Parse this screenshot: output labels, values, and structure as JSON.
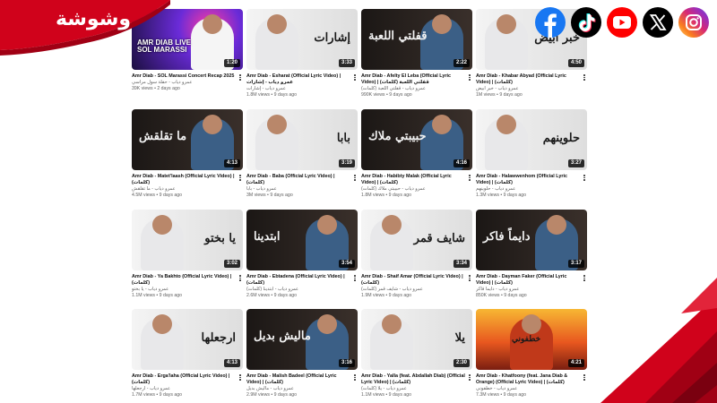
{
  "logo": {
    "text": "وشوشة",
    "color": "#d0021b"
  },
  "socials": [
    {
      "icon": "facebook-icon",
      "color": "#1877f2"
    },
    {
      "icon": "tiktok-icon",
      "color": "#000000"
    },
    {
      "icon": "youtube-icon",
      "color": "#ff0000"
    },
    {
      "icon": "x-icon",
      "color": "#000000"
    },
    {
      "icon": "instagram-icon",
      "color": "#d62976"
    }
  ],
  "videos": [
    {
      "title": "Amr Diab - SOL Marassi Concert Recap 2025",
      "channel": "عمرو دياب - حفلة سول مراسي",
      "stats": "39K views • 2 days ago",
      "duration": "1:20",
      "thumb_text": "AMR DIAB LIVE SOL MARASSI",
      "theme": "concert"
    },
    {
      "title": "Amr Diab - Esharat (Official Lyric Video) | عمرو دياب - إشارات",
      "channel": "عمرو دياب - إشارات",
      "stats": "1.8M views • 9 days ago",
      "duration": "3:33",
      "thumb_text": "إشارات",
      "theme": "light"
    },
    {
      "title": "Amr Diab - Afelty El Leba (Official Lyric Video) | (كلمات) قفلتي اللعبة",
      "channel": "عمرو دياب - قفلتي اللعبة (كلمات)",
      "stats": "990K views • 9 days ago",
      "duration": "2:22",
      "thumb_text": "قفلتي اللعبة",
      "theme": "dark"
    },
    {
      "title": "Amr Diab - Khabar Abyad (Official Lyric Video) | (كلمات)",
      "channel": "عمرو دياب - خبر أبيض",
      "stats": "1M views • 9 days ago",
      "duration": "4:50",
      "thumb_text": "خبر أبيض",
      "theme": "light"
    },
    {
      "title": "Amr Diab - Matet'laash (Official Lyric Video) | (كلمات)",
      "channel": "عمرو دياب - ما تقلقش",
      "stats": "4.5M views • 9 days ago",
      "duration": "4:13",
      "thumb_text": "ما تقلقش",
      "theme": "dark"
    },
    {
      "title": "Amr Diab - Baba (Official Lyric Video) | (كلمات)",
      "channel": "عمرو دياب - بابا",
      "stats": "3M views • 9 days ago",
      "duration": "3:19",
      "thumb_text": "بابا",
      "theme": "light"
    },
    {
      "title": "Amr Diab - Habibty Malak (Official Lyric Video) | (كلمات)",
      "channel": "عمرو دياب - حبيبتي ملاك (كلمات)",
      "stats": "1.8M views • 9 days ago",
      "duration": "4:16",
      "thumb_text": "حبيبتي ملاك",
      "theme": "dark"
    },
    {
      "title": "Amr Diab - Halawwenhom (Official Lyric Video) | (كلمات)",
      "channel": "عمرو دياب - حلوينهم",
      "stats": "1.3M views • 9 days ago",
      "duration": "3:27",
      "thumb_text": "حلوينهم",
      "theme": "light"
    },
    {
      "title": "Amr Diab - Ya Bakhto (Official Lyric Video) | (كلمات)",
      "channel": "عمرو دياب - يا بختو",
      "stats": "1.1M views • 9 days ago",
      "duration": "3:02",
      "thumb_text": "يا بختو",
      "theme": "light"
    },
    {
      "title": "Amr Diab - Ebtadena (Official Lyric Video) | (كلمات)",
      "channel": "عمرو دياب - ابتدينا (كلمات)",
      "stats": "2.6M views • 9 days ago",
      "duration": "3:54",
      "thumb_text": "ابتدينا",
      "theme": "dark"
    },
    {
      "title": "Amr Diab - Shaif Amar (Official Lyric Video) | (كلمات)",
      "channel": "عمرو دياب - شايف قمر (كلمات)",
      "stats": "1.9M views • 9 days ago",
      "duration": "3:34",
      "thumb_text": "شايف قمر",
      "theme": "light"
    },
    {
      "title": "Amr Diab - Dayman Faker (Official Lyric Video) | (كلمات)",
      "channel": "عمرو دياب - دايماً فاكر",
      "stats": "850K views • 9 days ago",
      "duration": "3:17",
      "thumb_text": "دايماً فاكر",
      "theme": "dark"
    },
    {
      "title": "Amr Diab - Erga'laha (Official Lyric Video) | (كلمات)",
      "channel": "عمرو دياب - ارجعلها",
      "stats": "1.7M views • 9 days ago",
      "duration": "4:13",
      "thumb_text": "ارجعلها",
      "theme": "light"
    },
    {
      "title": "Amr Diab - Malish Badeel (Official Lyric Video) | (كلمات)",
      "channel": "عمرو دياب - ماليش بديل",
      "stats": "2.9M views • 9 days ago",
      "duration": "3:16",
      "thumb_text": "ماليش بديل",
      "theme": "dark"
    },
    {
      "title": "Amr Diab - Yalla (feat. Abdallah Diab) (Official Lyric Video) | (كلمات)",
      "channel": "عمرو دياب - يلا (كلمات)",
      "stats": "1.1M views • 9 days ago",
      "duration": "2:30",
      "thumb_text": "يلا",
      "theme": "light"
    },
    {
      "title": "Amr Diab - Khatfoony (feat. Jana Diab & Orange) (Official Lyric Video) | (كلمات)",
      "channel": "عمرو دياب - خطفوني",
      "stats": "7.3M views • 9 days ago",
      "duration": "4:21",
      "thumb_text": "خطفوني",
      "theme": "sunset"
    }
  ]
}
